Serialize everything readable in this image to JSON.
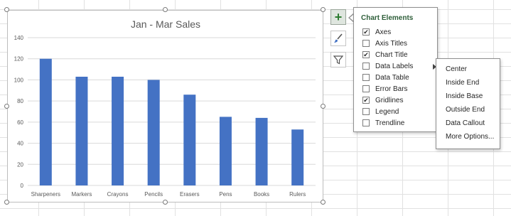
{
  "chart_data": {
    "type": "bar",
    "title": "Jan - Mar Sales",
    "categories": [
      "Sharpeners",
      "Markers",
      "Crayons",
      "Pencils",
      "Erasers",
      "Pens",
      "Books",
      "Rulers"
    ],
    "values": [
      120,
      103,
      103,
      100,
      86,
      65,
      64,
      53
    ],
    "ylim": [
      0,
      140
    ],
    "yticks": [
      "0",
      "20",
      "40",
      "60",
      "80",
      "100",
      "120",
      "140"
    ],
    "grid": true,
    "bar_color": "#4472c4"
  },
  "side_buttons": [
    "plus-icon",
    "brush-icon",
    "filter-icon"
  ],
  "panel": {
    "title": "Chart Elements",
    "options": [
      {
        "label": "Axes",
        "checked": true
      },
      {
        "label": "Axis Titles",
        "checked": false
      },
      {
        "label": "Chart Title",
        "checked": true
      },
      {
        "label": "Data Labels",
        "checked": false
      },
      {
        "label": "Data Table",
        "checked": false
      },
      {
        "label": "Error Bars",
        "checked": false
      },
      {
        "label": "Gridlines",
        "checked": true
      },
      {
        "label": "Legend",
        "checked": false
      },
      {
        "label": "Trendline",
        "checked": false
      }
    ]
  },
  "submenu": {
    "items": [
      "Center",
      "Inside End",
      "Inside Base",
      "Outside End",
      "Data Callout",
      "More Options..."
    ]
  }
}
